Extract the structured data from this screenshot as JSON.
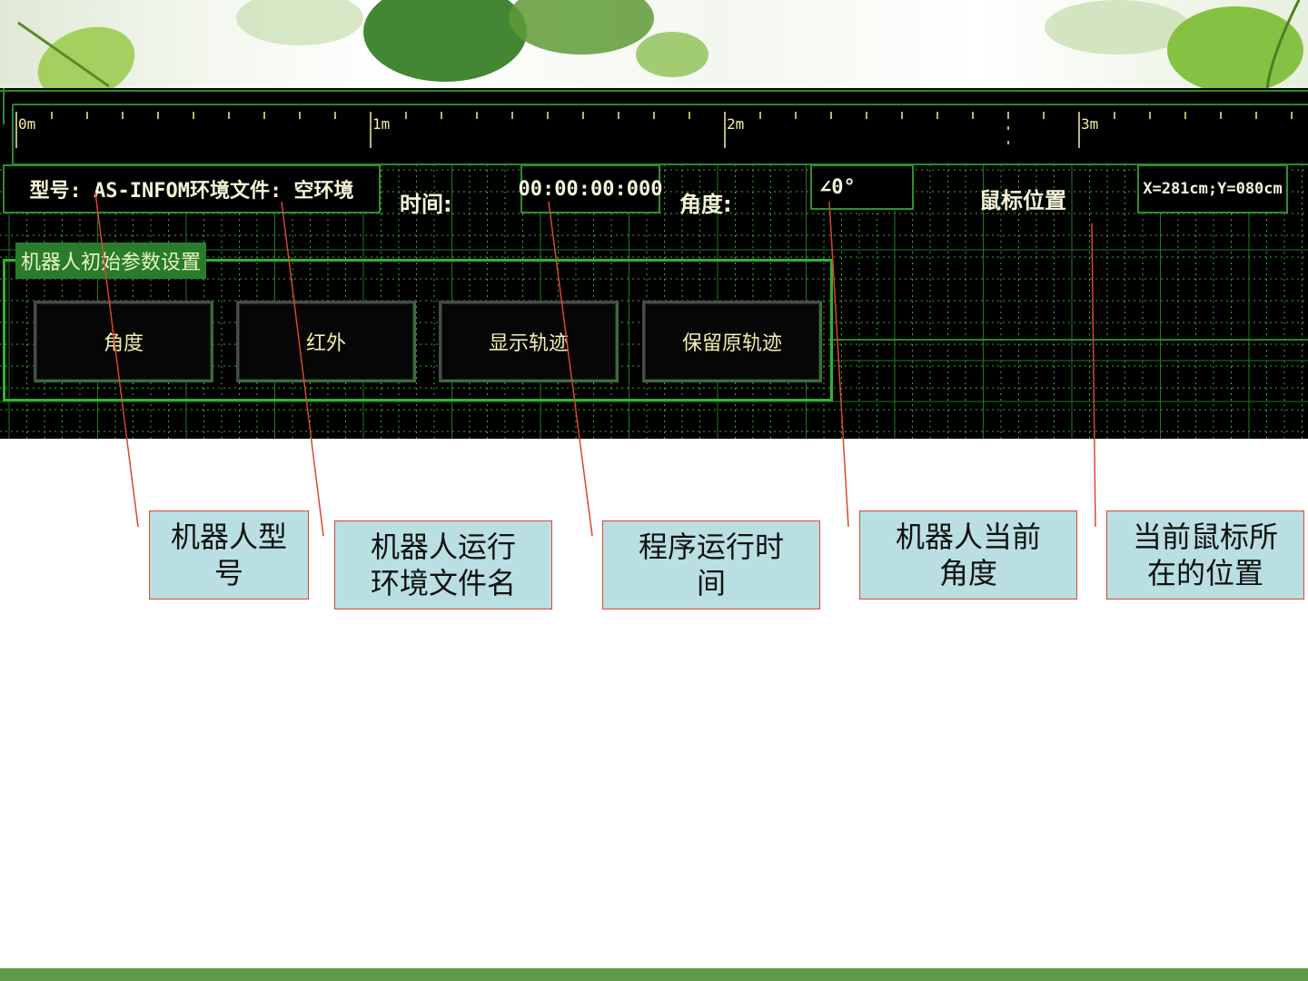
{
  "ruler": {
    "labels": [
      "0m",
      "1m",
      "2m",
      "3m"
    ]
  },
  "status": {
    "model_file": "型号: AS-INFOM环境文件: 空环境",
    "time_label": "时间:",
    "time_value": "00:00:00:000",
    "angle_label": "角度:",
    "angle_value": "∠0°",
    "mouse_label": "鼠标位置",
    "mouse_value": "X=281cm;Y=080cm"
  },
  "init_params": {
    "title": "机器人初始参数设置",
    "buttons": [
      "角度",
      "红外",
      "显示轨迹",
      "保留原轨迹"
    ]
  },
  "callouts": [
    {
      "line1": "机器人型",
      "line2": "号"
    },
    {
      "line1": "机器人运行",
      "line2": "环境文件名"
    },
    {
      "line1": "程序运行时",
      "line2": "间"
    },
    {
      "line1": "机器人当前",
      "line2": "角度"
    },
    {
      "line1": "当前鼠标所",
      "line2": "在的位置"
    }
  ],
  "colors": {
    "screen_bg": "#000000",
    "grid_green": "#2fb22f",
    "text_yellow": "#f4f0a0",
    "callout_bg": "#b9dfe2",
    "callout_border": "#d9472b",
    "leader_line": "#d9472b",
    "footer_green": "#5e9a4a"
  }
}
